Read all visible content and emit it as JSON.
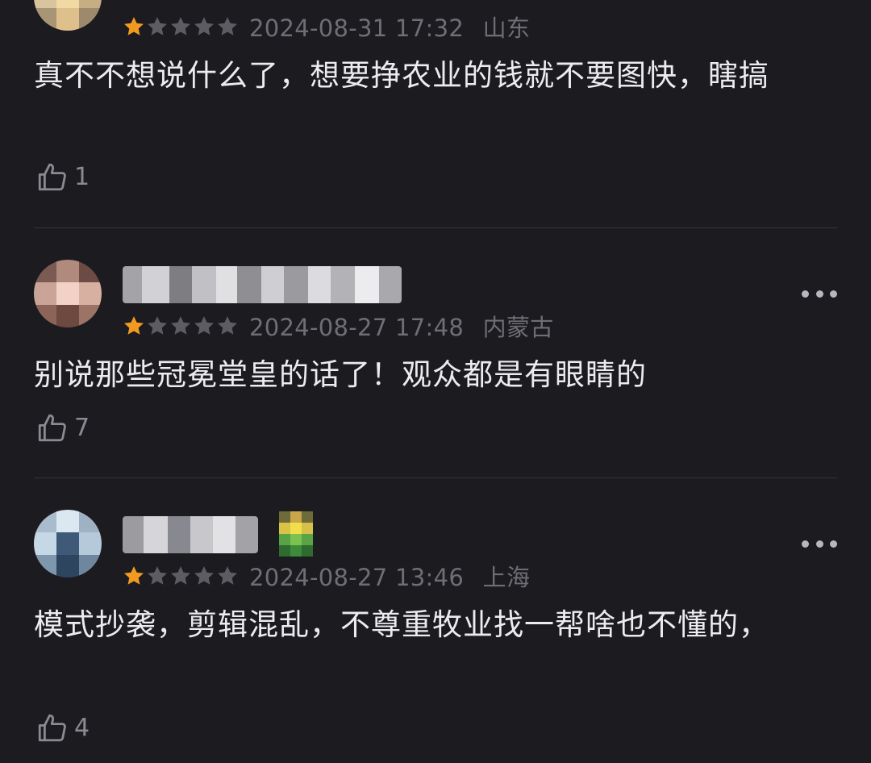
{
  "comments": [
    {
      "rating": 1,
      "date": "2024-08-31 17:32",
      "location": "山东",
      "text": "真不不想说什么了，想要挣农业的钱就不要图快，瞎搞",
      "likes": "1"
    },
    {
      "rating": 1,
      "date": "2024-08-27 17:48",
      "location": "内蒙古",
      "text": "别说那些冠冕堂皇的话了！观众都是有眼睛的",
      "likes": "7"
    },
    {
      "rating": 1,
      "date": "2024-08-27 13:46",
      "location": "上海",
      "text": "模式抄袭，剪辑混乱，不尊重牧业找一帮啥也不懂的，",
      "likes": "4"
    }
  ],
  "colors": {
    "background": "#1c1b20",
    "star_filled": "#f19a22",
    "star_empty": "#5d5c62",
    "meta_text": "#6f6e75",
    "divider": "#35343a"
  },
  "icons": {
    "like": "thumbs-up-icon",
    "star": "star-icon",
    "more": "more-dots-icon"
  }
}
